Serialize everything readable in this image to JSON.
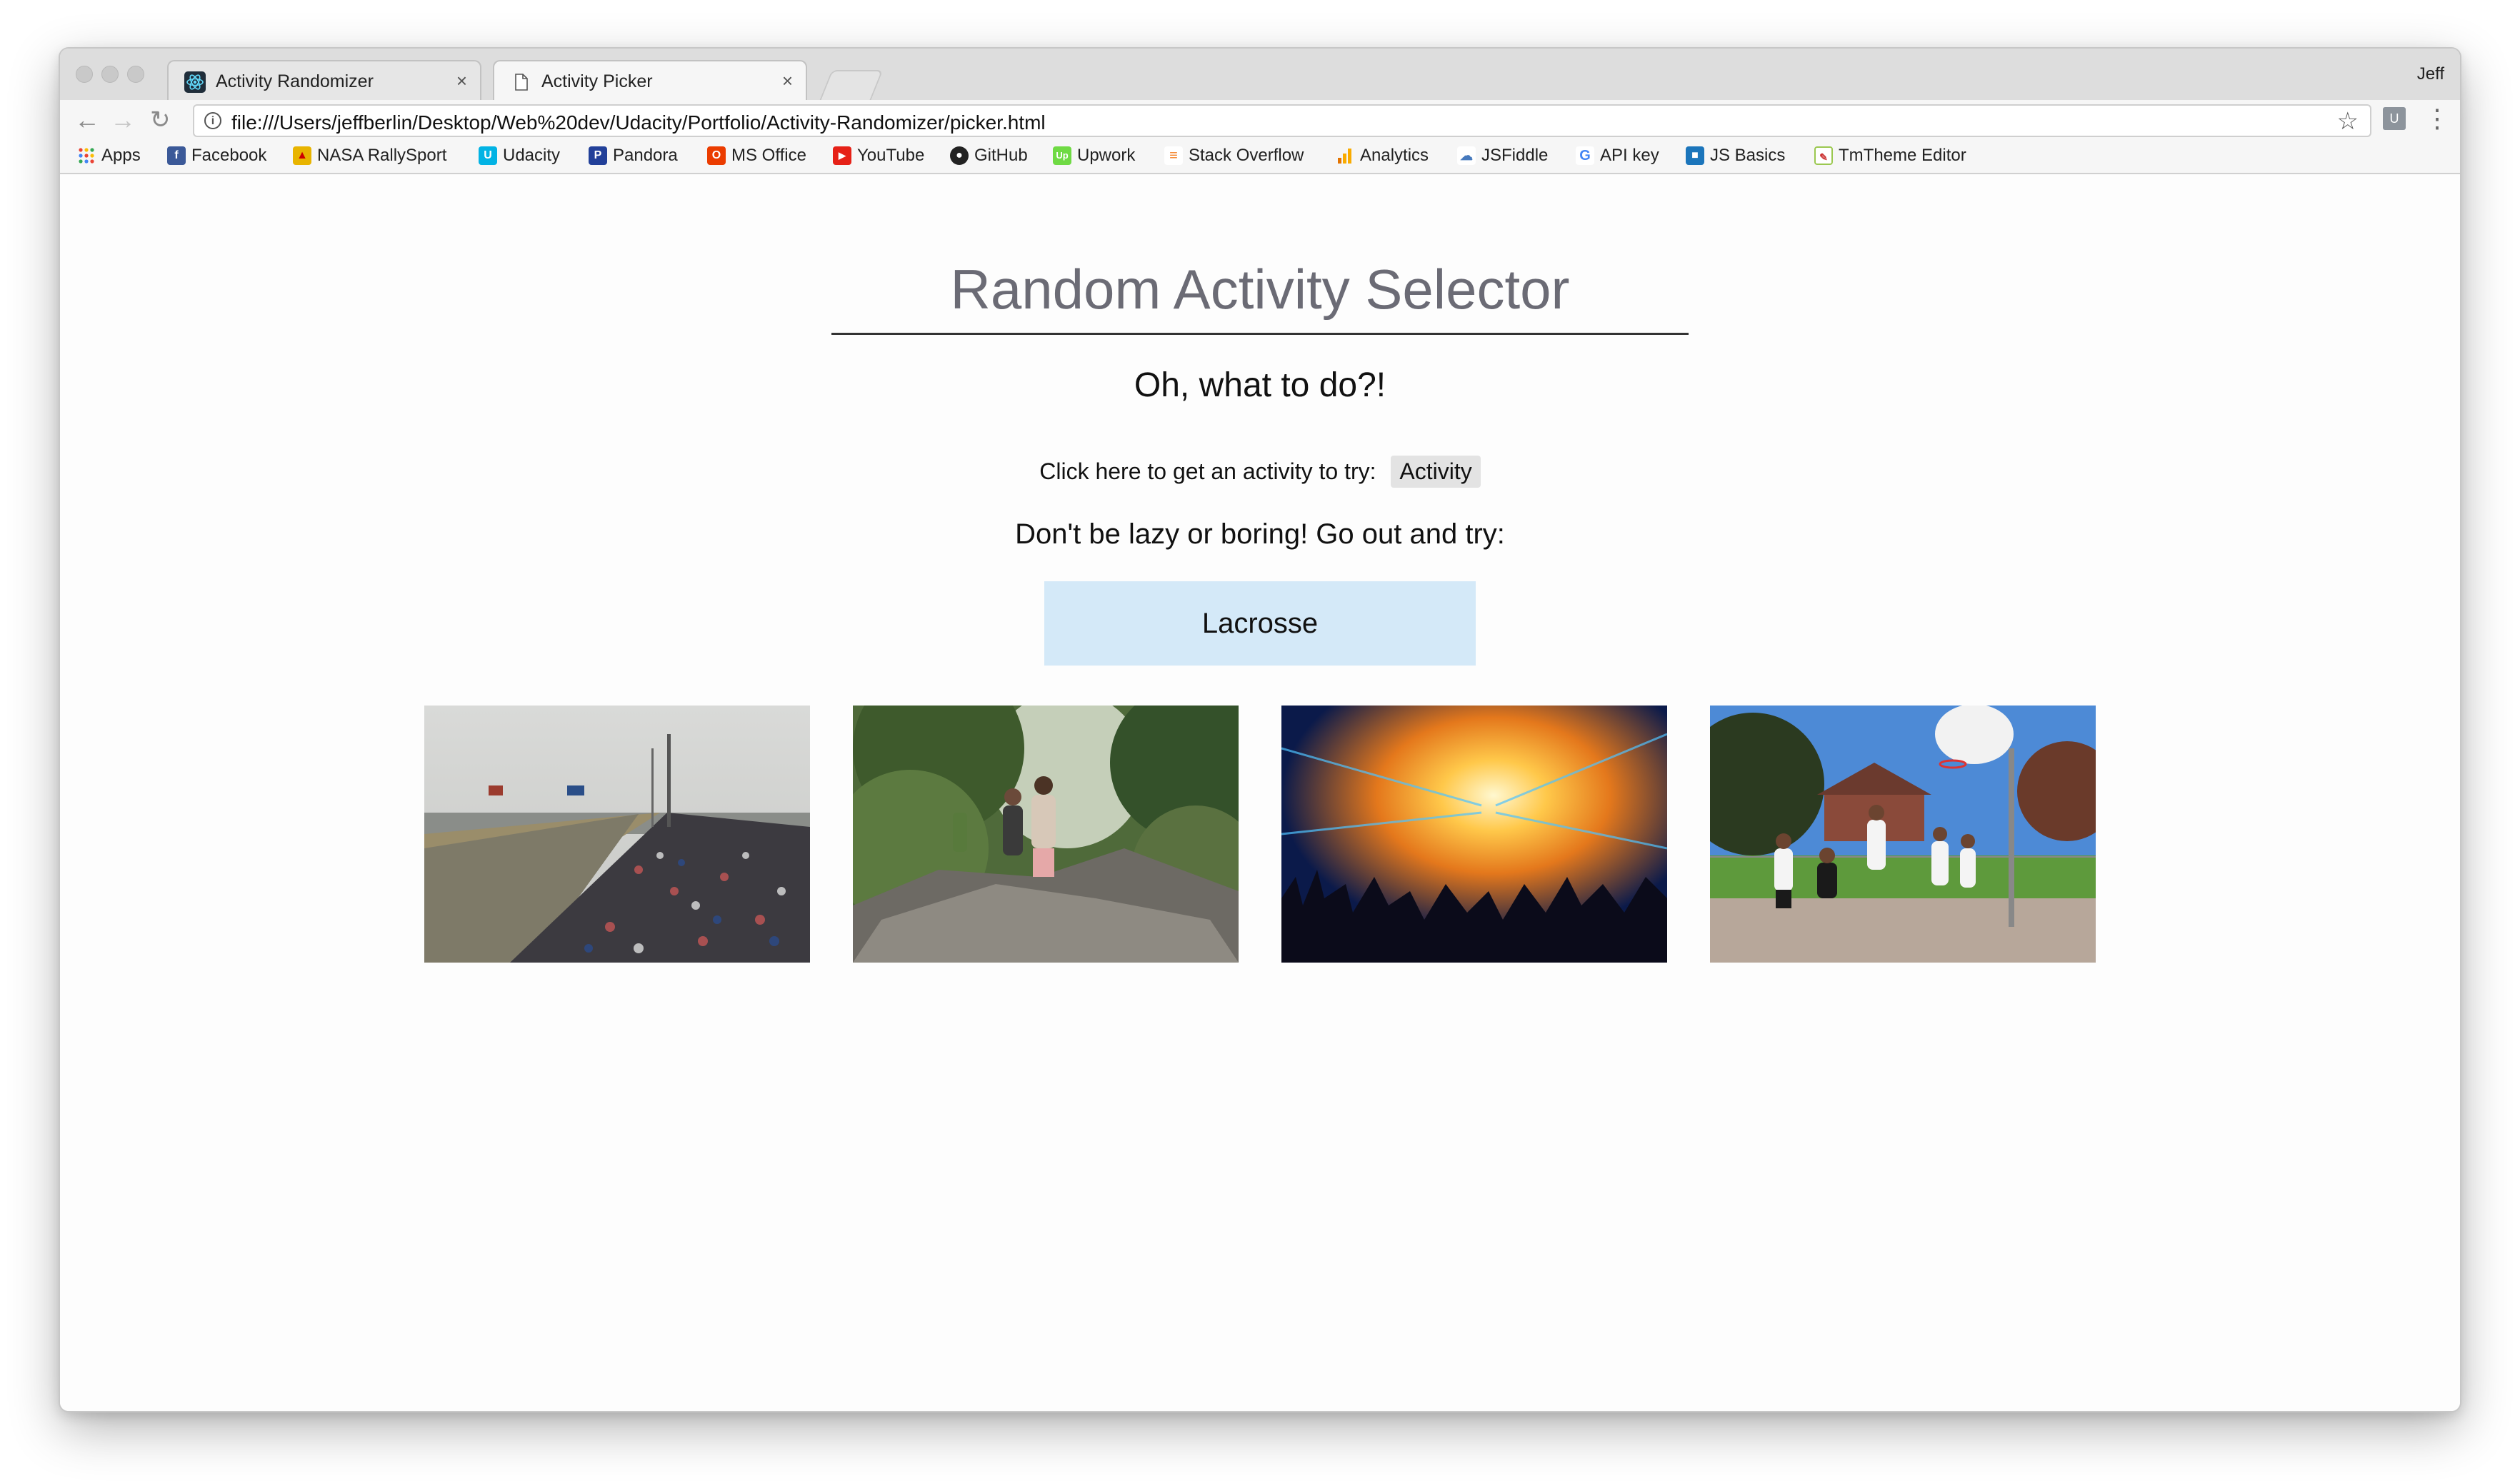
{
  "browser": {
    "tabs": [
      {
        "title": "Activity Randomizer",
        "active": false
      },
      {
        "title": "Activity Picker",
        "active": true
      }
    ],
    "profile_name": "Jeff",
    "url": "file:///Users/jeffberlin/Desktop/Web%20dev/Udacity/Portfolio/Activity-Randomizer/picker.html",
    "close_glyph": "×"
  },
  "bookmarks": [
    {
      "label": "Apps",
      "icon": "apps-grid-icon"
    },
    {
      "label": "Facebook",
      "icon": "facebook-icon",
      "color": "#3b5998"
    },
    {
      "label": "NASA RallySport",
      "icon": "rallysport-icon",
      "color": "#e8b400"
    },
    {
      "label": "Udacity",
      "icon": "udacity-icon",
      "color": "#02b3e4"
    },
    {
      "label": "Pandora",
      "icon": "pandora-icon",
      "color": "#224099"
    },
    {
      "label": "MS Office",
      "icon": "office-icon",
      "color": "#eb3c00"
    },
    {
      "label": "YouTube",
      "icon": "youtube-icon",
      "color": "#e62117"
    },
    {
      "label": "GitHub",
      "icon": "github-icon",
      "color": "#222222"
    },
    {
      "label": "Upwork",
      "icon": "upwork-icon",
      "color": "#6fda44"
    },
    {
      "label": "Stack Overflow",
      "icon": "stackoverflow-icon",
      "color": "#f48024"
    },
    {
      "label": "Analytics",
      "icon": "analytics-icon",
      "color": "#f9ab00"
    },
    {
      "label": "JSFiddle",
      "icon": "jsfiddle-icon",
      "color": "#4679bd"
    },
    {
      "label": "API key",
      "icon": "google-icon",
      "color": "#4285f4"
    },
    {
      "label": "JS Basics",
      "icon": "jsbasics-icon",
      "color": "#1b75bb"
    },
    {
      "label": "TmTheme Editor",
      "icon": "tmtheme-icon",
      "color": "#9bc850"
    }
  ],
  "page": {
    "title": "Random Activity Selector",
    "subtitle": "Oh, what to do?!",
    "prompt": "Click here to get an activity to try:",
    "button_label": "Activity",
    "tagline": "Don't be lazy or boring! Go out and try:",
    "result": "Lacrosse"
  },
  "photos": [
    "racing-crowd-photo",
    "hiking-photo",
    "concert-photo",
    "basketball-photo"
  ],
  "colors": {
    "result_bg": "#d4e9f8",
    "title": "#6b6b75",
    "button_bg": "#e3e3e3"
  }
}
